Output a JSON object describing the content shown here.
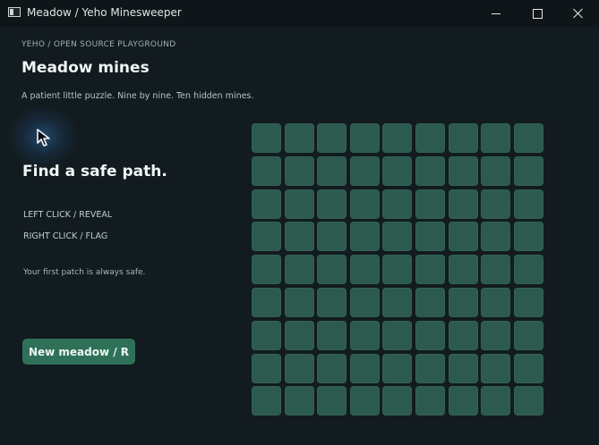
{
  "window": {
    "title": "Meadow / Yeho Minesweeper"
  },
  "header": {
    "eyebrow": "YEHO / OPEN SOURCE PLAYGROUND",
    "title": "Meadow mines",
    "subtitle": "A patient little puzzle. Nine by nine. Ten hidden mines."
  },
  "sidebar": {
    "status": "Find a safe path.",
    "help": [
      "LEFT CLICK / REVEAL",
      "RIGHT CLICK / FLAG"
    ],
    "note": "Your first patch is always safe.",
    "new_button_label": "New meadow / R"
  },
  "board": {
    "rows": 9,
    "cols": 9,
    "mines": 10,
    "state": "all cells covered",
    "cell_color": "#2c5a4e"
  },
  "colors": {
    "background": "#121b1f",
    "accent": "#2e7158",
    "cursor_glow": "#2d6eaa"
  },
  "icons": {
    "cursor": "arrow-cursor-icon",
    "app": "window-app-icon"
  }
}
